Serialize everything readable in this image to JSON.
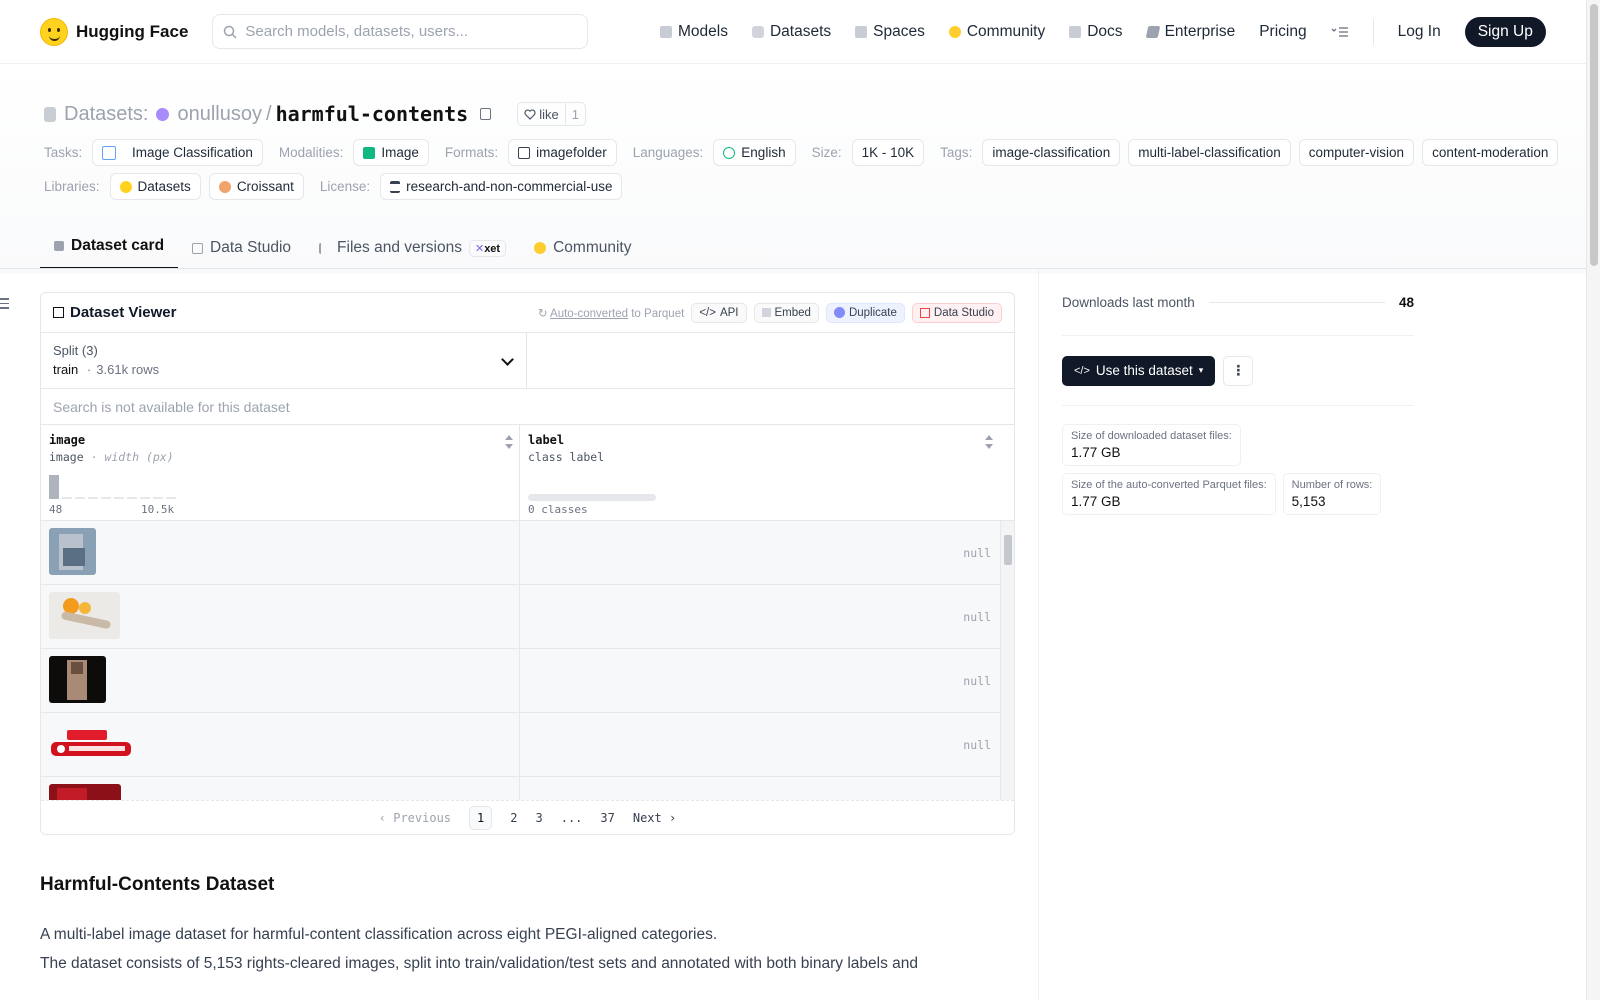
{
  "nav": {
    "brand": "Hugging Face",
    "search_placeholder": "Search models, datasets, users...",
    "links": [
      "Models",
      "Datasets",
      "Spaces",
      "Community",
      "Docs",
      "Enterprise",
      "Pricing"
    ],
    "login": "Log In",
    "signup": "Sign Up"
  },
  "repo": {
    "section": "Datasets:",
    "owner": "onullusoy",
    "separator": "/",
    "name": "harmful-contents",
    "like_label": "like",
    "like_count": "1"
  },
  "meta": {
    "tasks_label": "Tasks:",
    "task": "Image Classification",
    "modalities_label": "Modalities:",
    "modality": "Image",
    "formats_label": "Formats:",
    "format": "imagefolder",
    "languages_label": "Languages:",
    "language": "English",
    "size_label": "Size:",
    "size": "1K - 10K",
    "tags_label": "Tags:",
    "tags": [
      "image-classification",
      "multi-label-classification",
      "computer-vision",
      "content-moderation"
    ],
    "libraries_label": "Libraries:",
    "libraries": [
      "Datasets",
      "Croissant"
    ],
    "license_label": "License:",
    "license": "research-and-non-commercial-use"
  },
  "tabs": [
    "Dataset card",
    "Data Studio",
    "Files and versions",
    "Community"
  ],
  "tab_badge": "xet",
  "viewer": {
    "title": "Dataset Viewer",
    "auto_converted_link": "Auto-converted",
    "auto_converted_suffix": "to Parquet",
    "btn_api": "API",
    "btn_embed": "Embed",
    "btn_duplicate": "Duplicate",
    "btn_datastudio": "Data Studio",
    "split_label": "Split (3)",
    "split_name": "train",
    "split_dot": "·",
    "split_rows": "3.61k rows",
    "search_disabled": "Search is not available for this dataset",
    "col1_name": "image",
    "col1_type": "image",
    "col1_subtype": "· width (px)",
    "col1_min": "48",
    "col1_max": "10.5k",
    "col2_name": "label",
    "col2_type": "class label",
    "col2_classes": "0 classes",
    "null_text": "null",
    "pagination": {
      "prev": "Previous",
      "pages": [
        "1",
        "2",
        "3",
        "...",
        "37"
      ],
      "next": "Next",
      "current": "1"
    }
  },
  "sidebar": {
    "downloads_label": "Downloads last month",
    "downloads_value": "48",
    "use_button": "Use this dataset",
    "stats": [
      {
        "label": "Size of downloaded dataset files:",
        "value": "1.77 GB"
      },
      {
        "label": "Size of the auto-converted Parquet files:",
        "value": "1.77 GB"
      },
      {
        "label": "Number of rows:",
        "value": "5,153"
      }
    ]
  },
  "card": {
    "heading": "Harmful-Contents Dataset",
    "p1": "A multi-label image dataset for harmful-content classification across eight PEGI-aligned categories.",
    "p2": "The dataset consists of 5,153 rights-cleared images, split into train/validation/test sets and annotated with both binary labels and"
  },
  "colors": {
    "accent_dark": "#111827",
    "owner_dot": "#a78bfa",
    "hf_yellow": "#ffd21e"
  }
}
